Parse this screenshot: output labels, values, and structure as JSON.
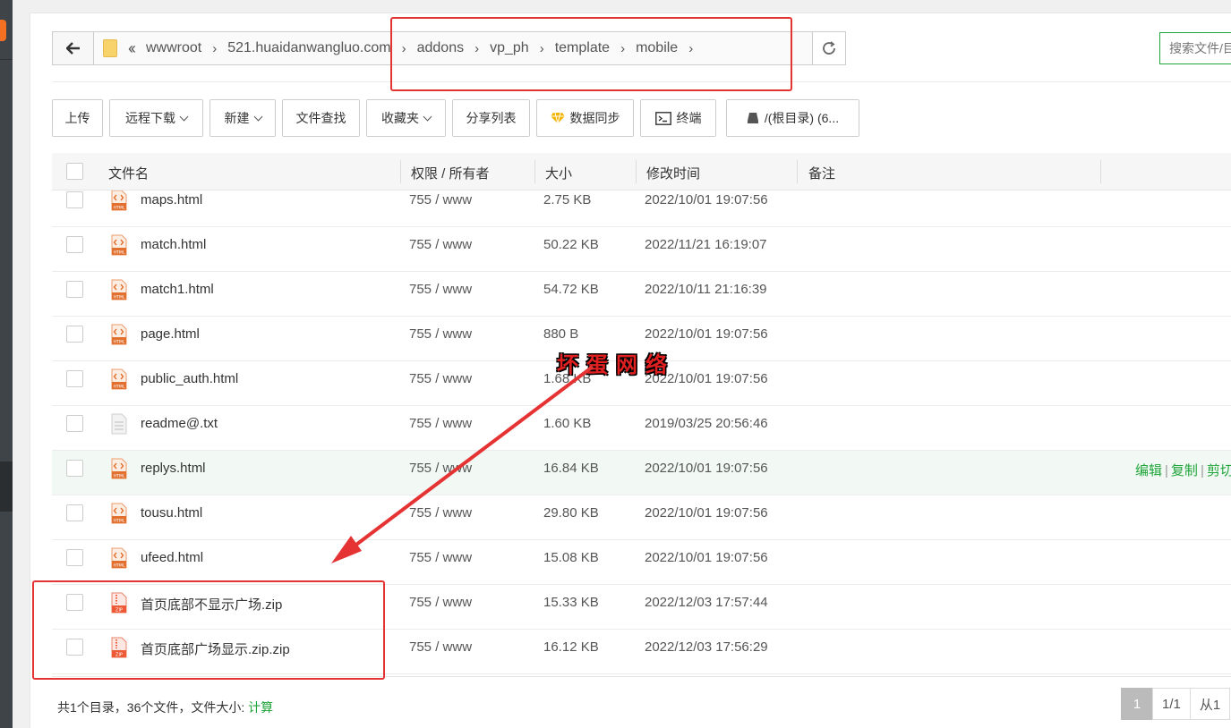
{
  "path": {
    "crumbs": [
      "wwwroot",
      "521.huaidanwangluo.com",
      "addons",
      "vp_ph",
      "template",
      "mobile"
    ]
  },
  "search": {
    "placeholder": "搜索文件/目录"
  },
  "toolbar": {
    "upload": "上传",
    "remote_download": "远程下载",
    "new": "新建",
    "file_search": "文件查找",
    "favorites": "收藏夹",
    "share_list": "分享列表",
    "data_sync": "数据同步",
    "terminal": "终端",
    "disk": "/(根目录) (6..."
  },
  "table": {
    "headers": {
      "name": "文件名",
      "perm": "权限 / 所有者",
      "size": "大小",
      "mtime": "修改时间",
      "remark": "备注"
    },
    "rows": [
      {
        "name": "maps.html",
        "perm": "755 / www",
        "size": "2.75 KB",
        "mtime": "2022/10/01 19:07:56",
        "type": "html"
      },
      {
        "name": "match.html",
        "perm": "755 / www",
        "size": "50.22 KB",
        "mtime": "2022/11/21 16:19:07",
        "type": "html"
      },
      {
        "name": "match1.html",
        "perm": "755 / www",
        "size": "54.72 KB",
        "mtime": "2022/10/11 21:16:39",
        "type": "html"
      },
      {
        "name": "page.html",
        "perm": "755 / www",
        "size": "880 B",
        "mtime": "2022/10/01 19:07:56",
        "type": "html"
      },
      {
        "name": "public_auth.html",
        "perm": "755 / www",
        "size": "1.68 KB",
        "mtime": "2022/10/01 19:07:56",
        "type": "html"
      },
      {
        "name": "readme@.txt",
        "perm": "755 / www",
        "size": "1.60 KB",
        "mtime": "2019/03/25 20:56:46",
        "type": "txt"
      },
      {
        "name": "replys.html",
        "perm": "755 / www",
        "size": "16.84 KB",
        "mtime": "2022/10/01 19:07:56",
        "type": "html"
      },
      {
        "name": "tousu.html",
        "perm": "755 / www",
        "size": "29.80 KB",
        "mtime": "2022/10/01 19:07:56",
        "type": "html"
      },
      {
        "name": "ufeed.html",
        "perm": "755 / www",
        "size": "15.08 KB",
        "mtime": "2022/10/01 19:07:56",
        "type": "html"
      },
      {
        "name": "首页底部不显示广场.zip",
        "perm": "755 / www",
        "size": "15.33 KB",
        "mtime": "2022/12/03 17:57:44",
        "type": "zip"
      },
      {
        "name": "首页底部广场显示.zip.zip",
        "perm": "755 / www",
        "size": "16.12 KB",
        "mtime": "2022/12/03 17:56:29",
        "type": "zip"
      }
    ],
    "hover_row": 6,
    "row_ops": [
      "编辑",
      "复制",
      "剪切"
    ]
  },
  "footer": {
    "summary": "共1个目录，36个文件，文件大小: ",
    "calc": "计算",
    "page_current": "1",
    "page_total": "1/1",
    "page_from": "从1"
  },
  "watermark": "坏蛋网络",
  "colors": {
    "accent": "#20a53a",
    "annotation": "#e53333"
  }
}
